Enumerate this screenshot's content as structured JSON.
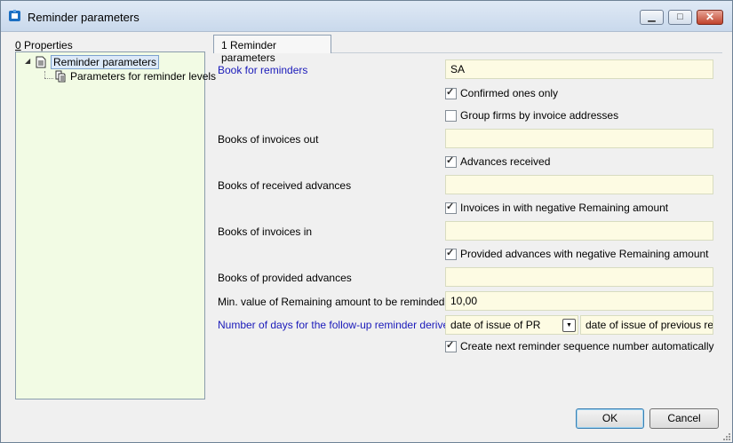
{
  "window": {
    "title": "Reminder parameters",
    "controls": {
      "minimize": "▁",
      "maximize": "□",
      "close": "✕"
    }
  },
  "sidebar": {
    "label_prefix": "0",
    "label_rest": " Properties",
    "tree": [
      {
        "label": "Reminder parameters",
        "selected": true
      },
      {
        "label": "Parameters for reminder levels",
        "selected": false
      }
    ]
  },
  "tab": {
    "label": "1 Reminder parameters"
  },
  "form": {
    "book_for_reminders_label": "Book for reminders",
    "book_for_reminders_value": "SA",
    "confirmed_only": {
      "label": "Confirmed ones only",
      "checked": true
    },
    "group_firms": {
      "label": "Group firms by invoice addresses",
      "checked": false
    },
    "books_invoices_out_label": "Books of invoices out",
    "books_invoices_out_value": "",
    "advances_received": {
      "label": "Advances received",
      "checked": true
    },
    "books_received_advances_label": "Books of received advances",
    "books_received_advances_value": "",
    "invoices_in_negative": {
      "label": "Invoices in with negative Remaining amount",
      "checked": true
    },
    "books_invoices_in_label": "Books of invoices in",
    "books_invoices_in_value": "",
    "provided_advances_negative": {
      "label": "Provided advances with negative Remaining amount",
      "checked": true
    },
    "books_provided_advances_label": "Books of provided advances",
    "books_provided_advances_value": "",
    "min_value_label": "Min. value of Remaining amount to be reminded",
    "min_value_value": "10,00",
    "days_followup_label": "Number of days for the follow-up reminder derive...",
    "days_followup_select": "date of issue of PR",
    "days_followup_second": "date of issue of previous remi",
    "create_next_seq": {
      "label": "Create next reminder sequence number automatically",
      "checked": true
    }
  },
  "buttons": {
    "ok": "OK",
    "cancel": "Cancel"
  },
  "colors": {
    "tree_bg": "#f2fbe4",
    "field_bg": "#fdfbe3",
    "link_label": "#1a1aba"
  }
}
